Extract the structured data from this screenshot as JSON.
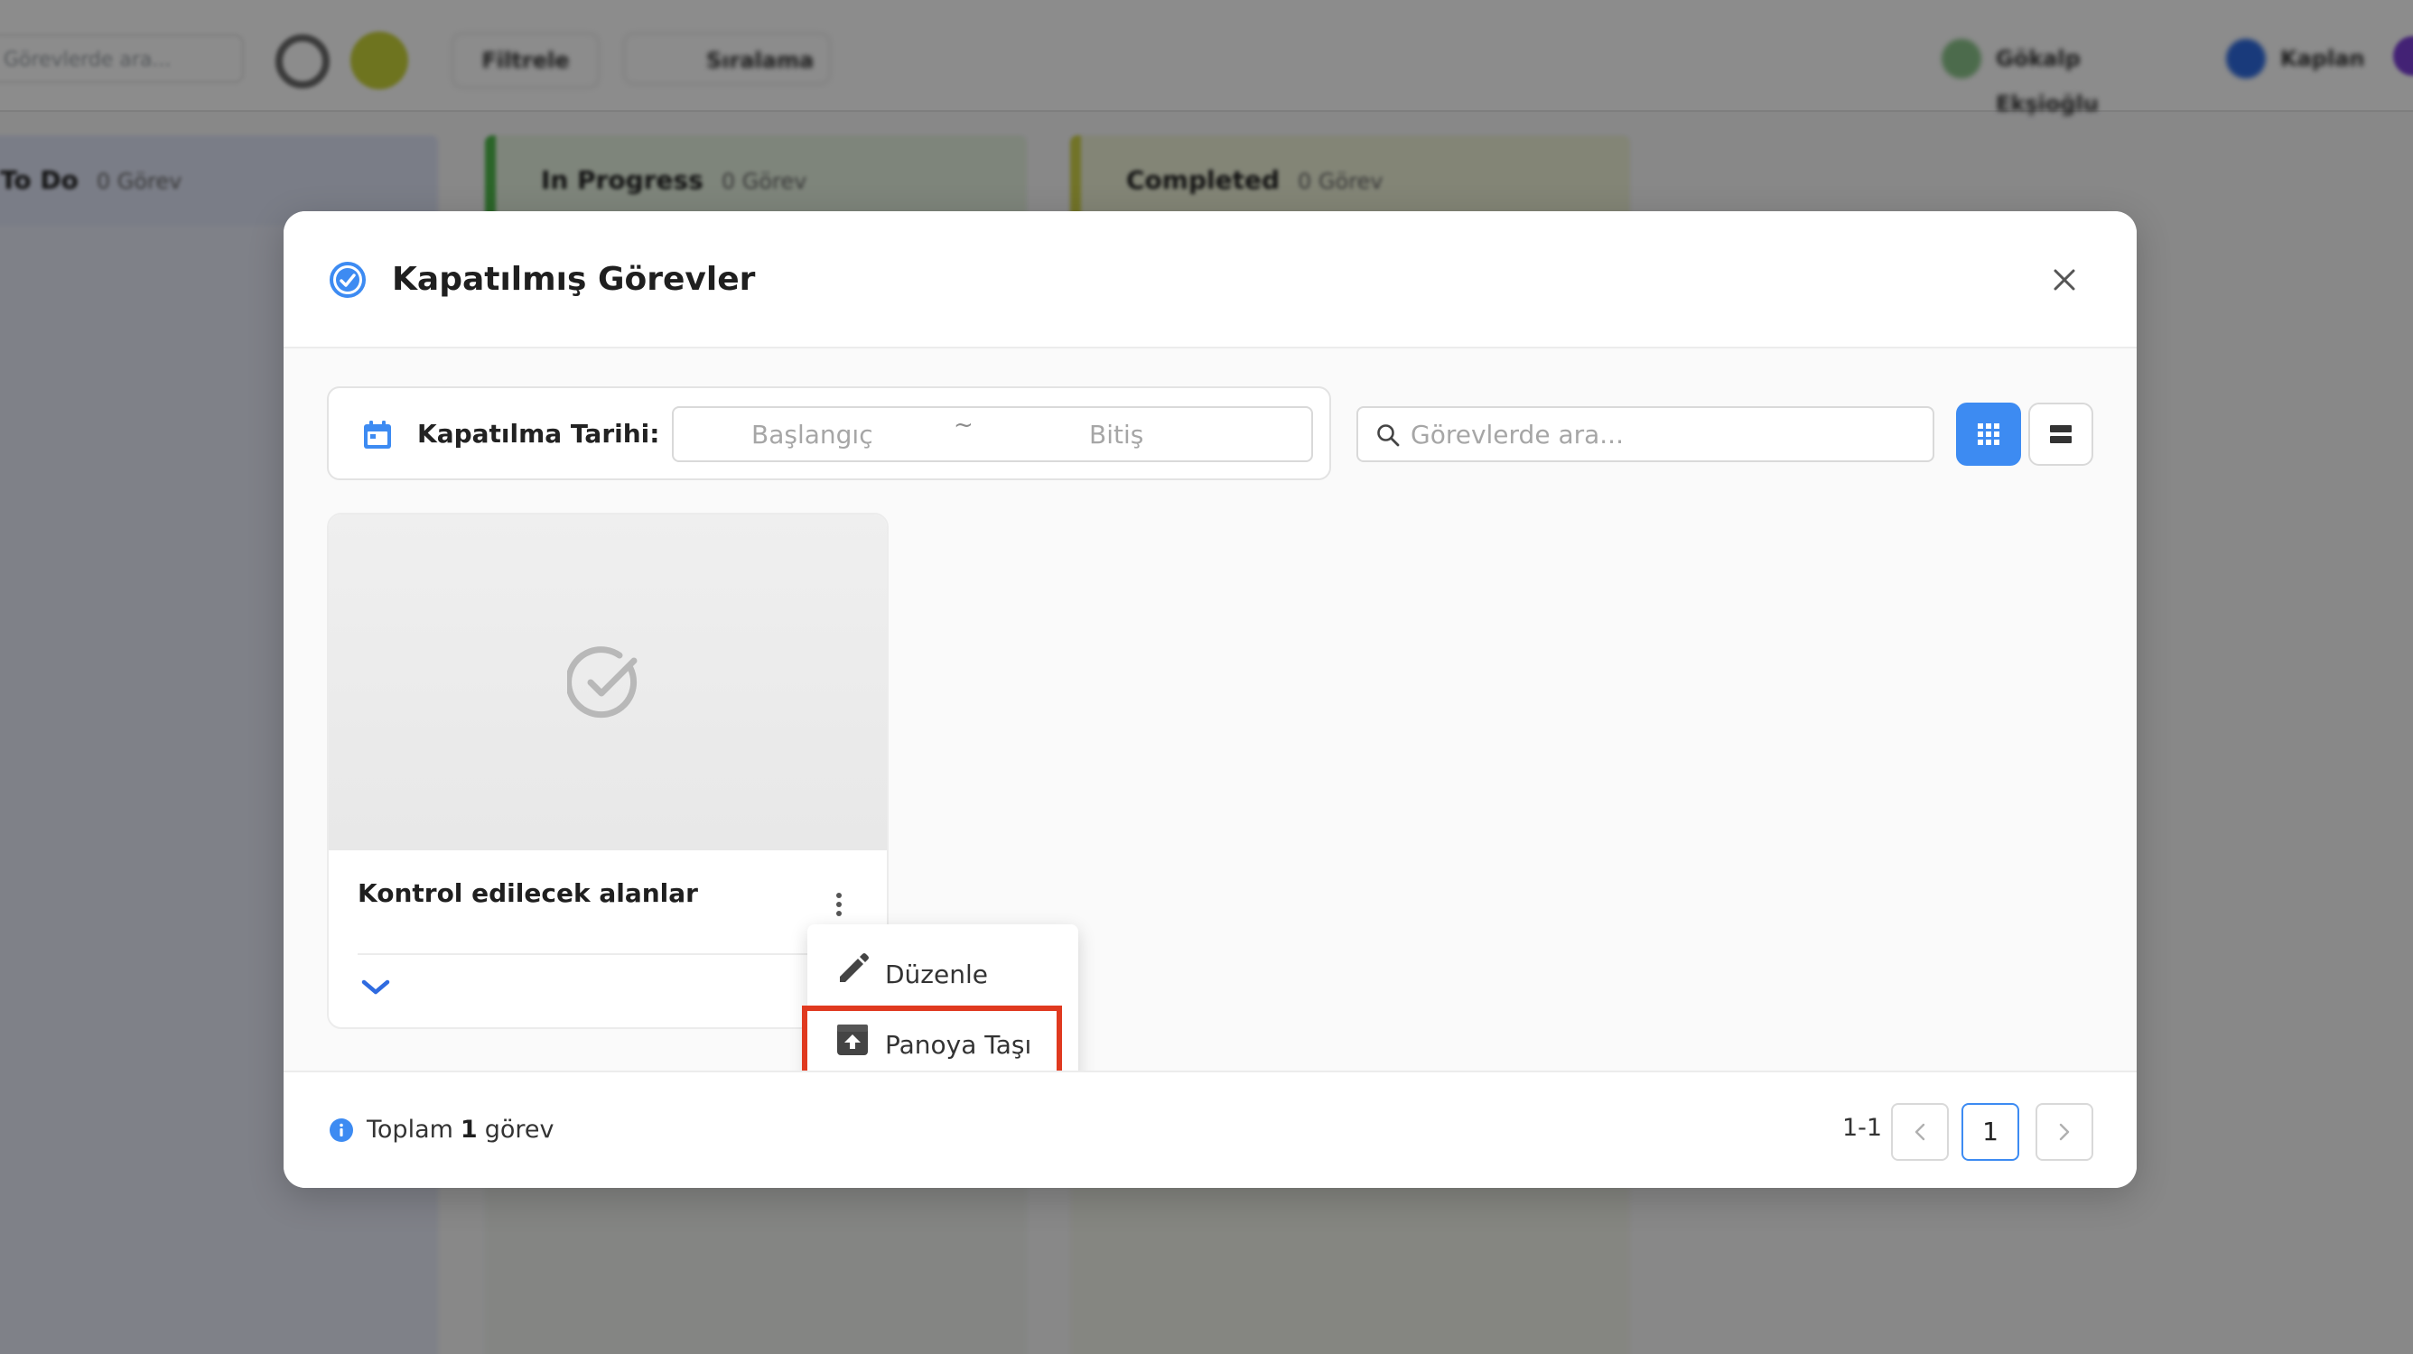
{
  "background": {
    "search_placeholder": "Görevlerde ara...",
    "filter_label": "Filtrele",
    "sort_label": "Sıralama",
    "user_1": "Gökalp Ekşioğlu",
    "user_2": "Kaplan",
    "columns": [
      {
        "label": "To Do",
        "count": "0 Görev"
      },
      {
        "label": "In Progress",
        "count": "0 Görev"
      },
      {
        "label": "Completed",
        "count": "0 Görev"
      }
    ]
  },
  "modal": {
    "title": "Kapatılmış Görevler",
    "header_icon": "check-circle-icon",
    "close_icon": "close-icon"
  },
  "filters": {
    "date_label": "Kapatılma Tarihi:",
    "date_start_placeholder": "Başlangıç",
    "date_separator": "~",
    "date_end_placeholder": "Bitiş",
    "search_placeholder": "Görevlerde ara...",
    "active_view": "grid"
  },
  "cards": [
    {
      "title": "Kontrol edilecek alanlar"
    }
  ],
  "context_menu": {
    "items": [
      {
        "label": "Düzenle",
        "icon": "pencil-icon"
      },
      {
        "label": "Panoya Taşı",
        "icon": "archive-upload-icon"
      }
    ]
  },
  "footer": {
    "total_prefix": "Toplam",
    "total_count": "1",
    "total_suffix": "görev",
    "page_range": "1-1",
    "current_page": "1"
  },
  "colors": {
    "accent": "#3d8bf2",
    "highlight": "#e0391f"
  }
}
